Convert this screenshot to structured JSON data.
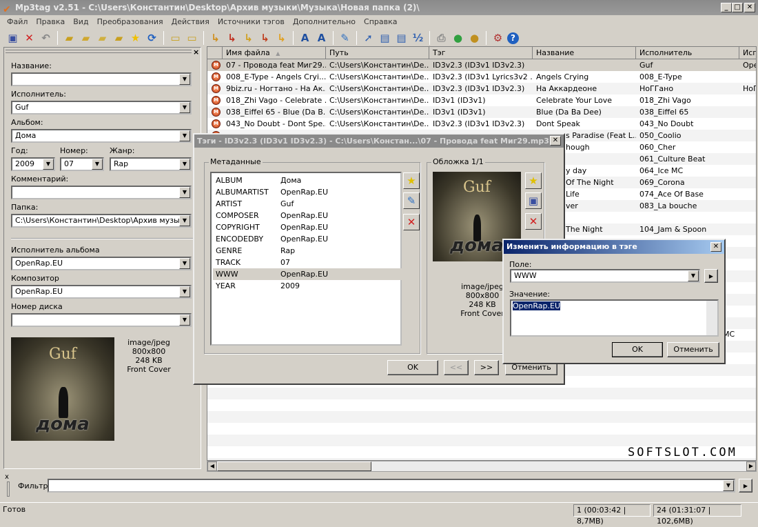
{
  "window": {
    "title": "Mp3tag v2.51  -  C:\\Users\\Константин\\Desktop\\Архив музыки\\Музыка\\Новая папка (2)\\"
  },
  "menu": [
    "Файл",
    "Правка",
    "Вид",
    "Преобразования",
    "Действия",
    "Источники тэгов",
    "Дополнительно",
    "Справка"
  ],
  "toolbar": [
    {
      "name": "save-icon",
      "glyph": "▣",
      "color": "#3a4fa0"
    },
    {
      "name": "remove-tag-icon",
      "glyph": "✕",
      "color": "#d02020"
    },
    {
      "name": "undo-icon",
      "glyph": "↶",
      "color": "#888"
    },
    {
      "sep": true
    },
    {
      "name": "change-directory-icon",
      "glyph": "▰",
      "color": "#c8a020"
    },
    {
      "name": "add-directory-icon",
      "glyph": "▰",
      "color": "#d0a830"
    },
    {
      "name": "open-folder-icon",
      "glyph": "▰",
      "color": "#d0b040"
    },
    {
      "name": "favorite-folder-icon",
      "glyph": "▰",
      "color": "#c8a020"
    },
    {
      "name": "star-icon",
      "glyph": "★",
      "color": "#f0c000"
    },
    {
      "name": "refresh-icon",
      "glyph": "⟳",
      "color": "#2060c0"
    },
    {
      "sep": true
    },
    {
      "name": "copy-tag-icon",
      "glyph": "▭",
      "color": "#c8a020"
    },
    {
      "name": "paste-tag-icon",
      "glyph": "▭",
      "color": "#c8a020"
    },
    {
      "sep": true
    },
    {
      "name": "tag-to-filename-icon",
      "glyph": "↳",
      "color": "#d09020"
    },
    {
      "name": "filename-to-tag-icon",
      "glyph": "↳",
      "color": "#c03020"
    },
    {
      "name": "tag-to-tag-icon",
      "glyph": "↳",
      "color": "#d0a020"
    },
    {
      "name": "text-to-tag-icon",
      "glyph": "↳",
      "color": "#c04020"
    },
    {
      "name": "tag-to-text-icon",
      "glyph": "↳",
      "color": "#e0a020"
    },
    {
      "sep": true
    },
    {
      "name": "case-conversion-icon",
      "glyph": "A",
      "color": "#2050a0"
    },
    {
      "name": "replace-icon",
      "glyph": "A",
      "color": "#2050a0"
    },
    {
      "sep": true
    },
    {
      "name": "edit-icon",
      "glyph": "✎",
      "color": "#3070c0"
    },
    {
      "sep": true
    },
    {
      "name": "export-icon",
      "glyph": "➚",
      "color": "#3060b0"
    },
    {
      "name": "playlist-icon",
      "glyph": "▤",
      "color": "#3060b0"
    },
    {
      "name": "list-icon",
      "glyph": "▤",
      "color": "#3060b0"
    },
    {
      "name": "numbering-icon",
      "glyph": "½",
      "color": "#3060b0"
    },
    {
      "sep": true
    },
    {
      "name": "print-icon",
      "glyph": "⎙",
      "color": "#888"
    },
    {
      "name": "web-source-icon",
      "glyph": "●",
      "color": "#30a040"
    },
    {
      "name": "freedb-icon",
      "glyph": "●",
      "color": "#c09020"
    },
    {
      "sep": true
    },
    {
      "name": "options-icon",
      "glyph": "⚙",
      "color": "#b03030"
    },
    {
      "name": "help-icon",
      "glyph": "?",
      "color": "#fff"
    }
  ],
  "left_panel": {
    "fields": [
      {
        "label": "Название:",
        "value": ""
      },
      {
        "label": "Исполнитель:",
        "value": "Guf"
      },
      {
        "label": "Альбом:",
        "value": "Дома"
      },
      {
        "label": "Год:",
        "value": "2009"
      },
      {
        "label": "Номер:",
        "value": "07"
      },
      {
        "label": "Жанр:",
        "value": "Rap"
      },
      {
        "label": "Комментарий:",
        "value": ""
      },
      {
        "label": "Папка:",
        "value": "C:\\Users\\Константин\\Desktop\\Архив музыки\\Музыка"
      },
      {
        "label": "Исполнитель альбома",
        "value": "OpenRap.EU"
      },
      {
        "label": "Композитор",
        "value": "OpenRap.EU"
      },
      {
        "label": "Номер диска",
        "value": ""
      }
    ],
    "cover": {
      "type": "image/jpeg",
      "size": "800x800",
      "bytes": "248 KB",
      "kind": "Front Cover",
      "artist_art": "Guf",
      "album_art": "дома"
    }
  },
  "file_list": {
    "columns": [
      "Имя файла",
      "Путь",
      "Тэг",
      "Название",
      "Исполнитель",
      "Исп"
    ],
    "rows": [
      [
        "07 - Провода feat Миг29...",
        "C:\\Users\\Константин\\De...",
        "ID3v2.3 (ID3v1 ID3v2.3)",
        "",
        "Guf",
        "Ope"
      ],
      [
        "008_E-Type - Angels Cryi...",
        "C:\\Users\\Константин\\De...",
        "ID3v2.3 (ID3v1 Lyrics3v2 ...",
        "Angels Crying",
        "008_E-Type",
        ""
      ],
      [
        "9biz.ru - Ногтано - На Ак...",
        "C:\\Users\\Константин\\De...",
        "ID3v2.3 (ID3v1 ID3v2.3)",
        "На Аккардеоне",
        "НоГГано",
        "НоГ"
      ],
      [
        "018_Zhi Vago - Celebrate ...",
        "C:\\Users\\Константин\\De...",
        "ID3v1 (ID3v1)",
        "Celebrate Your Love",
        "018_Zhi Vago",
        ""
      ],
      [
        "038_Eiffel 65 - Blue (Da B...",
        "C:\\Users\\Константин\\De...",
        "ID3v1 (ID3v1)",
        "Blue (Da Ba Dee)",
        "038_Eiffel 65",
        ""
      ],
      [
        "043_No Doubt - Dont Spe...",
        "C:\\Users\\Константин\\De...",
        "ID3v2.3 (ID3v1 ID3v2.3)",
        "Dont Speak",
        "043_No Doubt",
        ""
      ],
      [
        "",
        "",
        "",
        "s Paradise (Feat L...",
        "050_Coolio",
        ""
      ],
      [
        "",
        "",
        "",
        "hough",
        "060_Cher",
        ""
      ],
      [
        "",
        "",
        "",
        "",
        "061_Culture Beat",
        ""
      ],
      [
        "",
        "",
        "",
        "y day",
        "064_Ice MC",
        ""
      ],
      [
        "",
        "",
        "",
        "Of The Night",
        "069_Corona",
        ""
      ],
      [
        "",
        "",
        "",
        "Life",
        "074_Ace Of Base",
        ""
      ],
      [
        "",
        "",
        "",
        "ver",
        "083_La bouche",
        ""
      ],
      [
        "",
        "",
        "",
        "",
        "",
        ""
      ],
      [
        "",
        "",
        "",
        "The Night",
        "104_Jam & Spoon",
        ""
      ]
    ],
    "partial_text": "MC",
    "watermark": "SOFTSLOT.COM"
  },
  "tag_dialog": {
    "title": "Тэги - ID3v2.3 (ID3v1 ID3v2.3) - C:\\Users\\Констан...\\07 - Провода feat Миг29.mp3",
    "metadata_label": "Метаданные",
    "metadata": [
      [
        "ALBUM",
        "Дома"
      ],
      [
        "ALBUMARTIST",
        "OpenRap.EU"
      ],
      [
        "ARTIST",
        "Guf"
      ],
      [
        "COMPOSER",
        "OpenRap.EU"
      ],
      [
        "COPYRIGHT",
        "OpenRap.EU"
      ],
      [
        "ENCODEDBY",
        "OpenRap.EU"
      ],
      [
        "GENRE",
        "Rap"
      ],
      [
        "TRACK",
        "07"
      ],
      [
        "WWW",
        "OpenRap.EU"
      ],
      [
        "YEAR",
        "2009"
      ]
    ],
    "selected_index": 8,
    "cover_label": "Обложка 1/1",
    "cover": {
      "type": "image/jpeg",
      "size": "800x800",
      "bytes": "248 KB",
      "kind": "Front Cover"
    },
    "ok": "OK",
    "prev": "<<",
    "next": ">>",
    "cancel": "Отменить"
  },
  "edit_dialog": {
    "title": "Изменить информацию в тэге",
    "field_label": "Поле:",
    "field_value": "WWW",
    "value_label": "Значение:",
    "value": "OpenRap.EU",
    "ok": "OK",
    "cancel": "Отменить"
  },
  "filter": {
    "label": "Фильтр",
    "value": ""
  },
  "status": {
    "text": "Готов",
    "selection": "1 (00:03:42 | 8,7MB)",
    "total": "24 (01:31:07 | 102,6MB)"
  },
  "colors": {
    "active_title": "#0a246a",
    "selection": "#0a246a",
    "inactive_title": "#8a8a8a"
  }
}
